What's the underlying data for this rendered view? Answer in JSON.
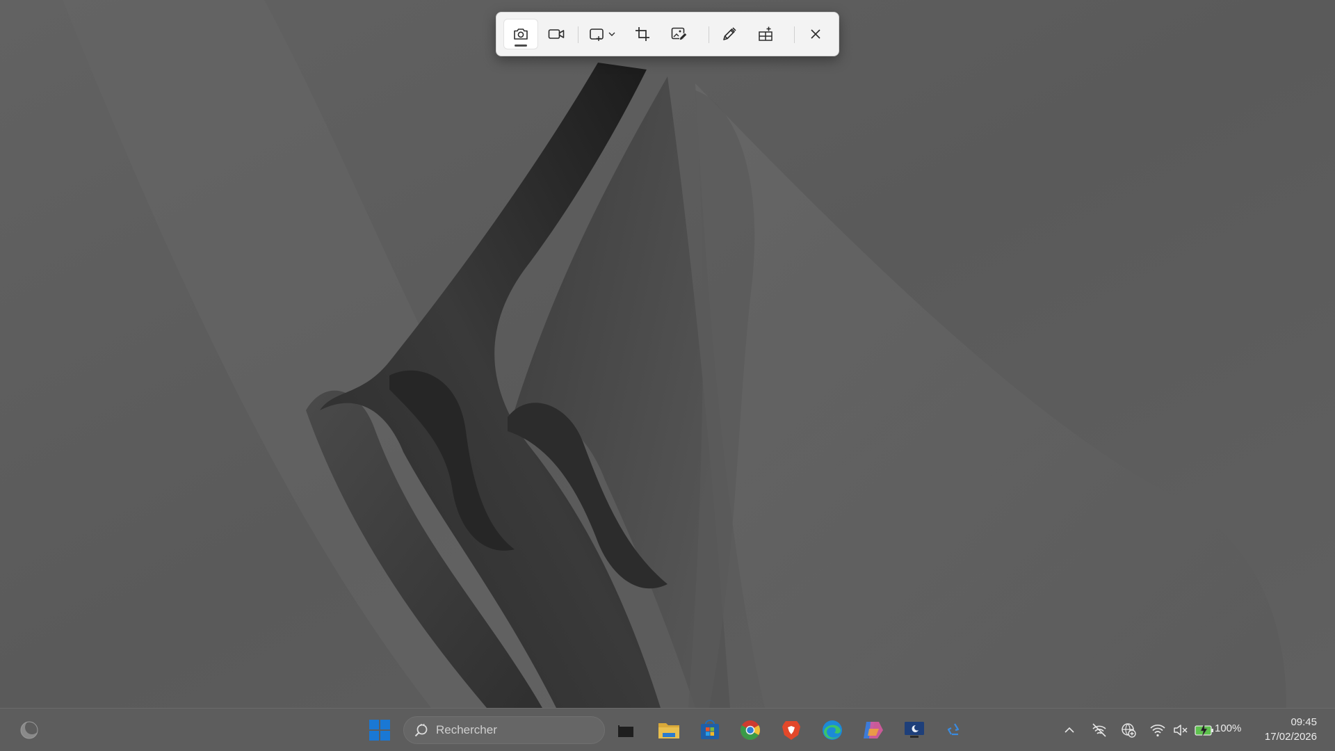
{
  "snipping_toolbar": {
    "buttons": [
      {
        "icon": "camera-icon",
        "state": "selected"
      },
      {
        "icon": "video-camera-icon"
      },
      {
        "icon": "rectangle-mode-icon"
      },
      {
        "icon": "crop-icon"
      },
      {
        "icon": "image-edit-icon"
      },
      {
        "icon": "pen-icon"
      },
      {
        "icon": "add-window-icon"
      },
      {
        "icon": "close-icon"
      }
    ]
  },
  "taskbar": {
    "search": {
      "placeholder": "Rechercher"
    },
    "pinned_apps": [
      "start-icon",
      "task-view-icon",
      "file-explorer-icon",
      "microsoft-store-icon",
      "chrome-icon",
      "brave-icon",
      "edge-icon",
      "copilot-icon",
      "remote-desktop-icon",
      "recycle-icon"
    ],
    "tray": {
      "battery_percent": "100%",
      "time": "09:45",
      "date": "17/02/2026"
    }
  },
  "colors": {
    "overlay": "#5e5e5e",
    "toolbar_bg": "#f3f3f3",
    "taskbar_bg": "#5d5d5d",
    "accent_blue": "#1a78d4"
  }
}
